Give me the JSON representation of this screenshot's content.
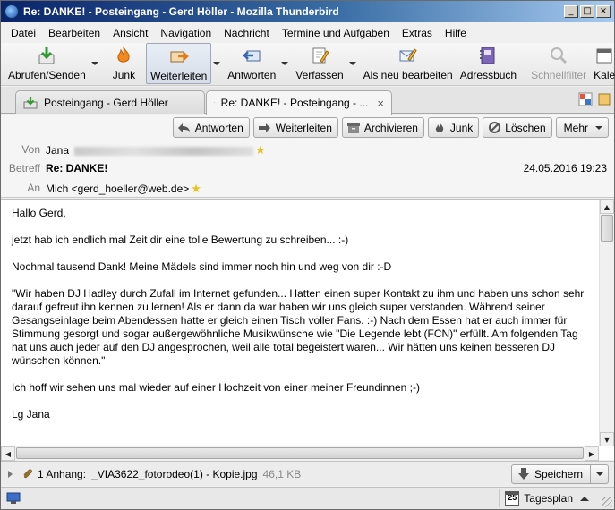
{
  "window": {
    "title": "Re: DANKE! - Posteingang - Gerd Höller - Mozilla Thunderbird",
    "controls": {
      "minimize": "_",
      "maximize": "□",
      "close": "×"
    }
  },
  "menubar": {
    "items": [
      {
        "label": "Datei"
      },
      {
        "label": "Bearbeiten"
      },
      {
        "label": "Ansicht"
      },
      {
        "label": "Navigation"
      },
      {
        "label": "Nachricht"
      },
      {
        "label": "Termine und Aufgaben"
      },
      {
        "label": "Extras"
      },
      {
        "label": "Hilfe"
      }
    ]
  },
  "toolbar": {
    "get_mail": "Abrufen/Senden",
    "junk": "Junk",
    "forward": "Weiterleiten",
    "reply": "Antworten",
    "compose": "Verfassen",
    "edit_as_new": "Als neu bearbeiten",
    "address_book": "Adressbuch",
    "quick_filter": "Schnellfilter",
    "calendar_partial": "Kale"
  },
  "tabs": [
    {
      "label": "Posteingang - Gerd Höller",
      "icon": "inbox-icon"
    },
    {
      "label": "Re: DANKE! - Posteingang - ...",
      "icon": "envelope-icon",
      "close": "×"
    }
  ],
  "header_buttons": {
    "reply": "Antworten",
    "forward": "Weiterleiten",
    "archive": "Archivieren",
    "junk": "Junk",
    "delete": "Löschen",
    "more": "Mehr"
  },
  "message": {
    "from_label": "Von",
    "from_name": "Jana",
    "subject_label": "Betreff",
    "subject": "Re: DANKE!",
    "date": "24.05.2016 19:23",
    "to_label": "An",
    "to": "Mich <gerd_hoeller@web.de>",
    "body": [
      "Hallo Gerd,",
      "jetzt hab ich endlich mal Zeit dir eine tolle Bewertung zu schreiben... :-)",
      "Nochmal tausend Dank! Meine Mädels sind immer noch hin und weg von dir :-D",
      "\"Wir haben DJ Hadley durch Zufall im Internet gefunden... Hatten einen super Kontakt zu ihm und haben uns schon sehr darauf gefreut ihn kennen zu lernen! Als er dann da war haben wir uns gleich super verstanden. Während seiner Gesangseinlage beim Abendessen hatte er gleich einen Tisch voller Fans. :-) Nach dem Essen hat er auch immer für Stimmung gesorgt und sogar außergewöhnliche Musikwünsche wie \"Die Legende lebt (FCN)\" erfüllt. Am folgenden Tag hat uns auch jeder auf den DJ angesprochen, weil alle total begeistert waren... Wir hätten uns keinen besseren DJ wünschen können.\"",
      "Ich hoff wir sehen uns mal wieder auf einer Hochzeit von einer meiner Freundinnen ;-)",
      "Lg Jana"
    ]
  },
  "attachment": {
    "summary": "1 Anhang:",
    "filename": "_VIA3622_fotorodeo(1) - Kopie.jpg",
    "size": "46,1 KB",
    "save_label": "Speichern"
  },
  "statusbar": {
    "calendar_day": "25",
    "today_pane_label": "Tagesplan"
  },
  "colors": {
    "titlebar_start": "#0a246a",
    "titlebar_end": "#a6caf0",
    "star": "#e9c21b",
    "junk_flame": "#f08a1c"
  }
}
